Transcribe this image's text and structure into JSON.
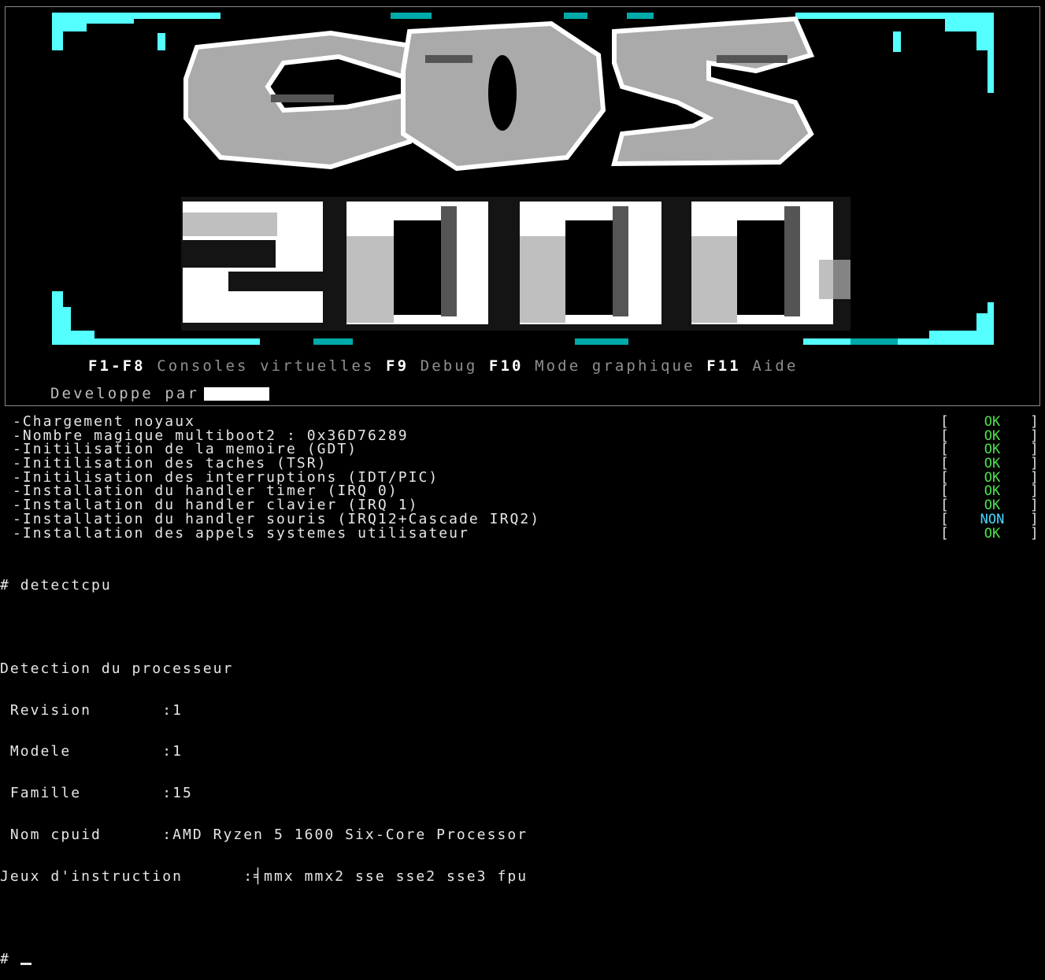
{
  "logo": {
    "top_text": "OS",
    "year_text": "2000",
    "colors": {
      "cyan": "#55ffff",
      "teal": "#00aaaa",
      "gray": "#aaaaaa",
      "dark": "#555555",
      "white": "#ffffff"
    }
  },
  "help_bar": [
    {
      "key": "F1-F8",
      "desc": "Consoles virtuelles"
    },
    {
      "key": "F9",
      "desc": "Debug"
    },
    {
      "key": "F10",
      "desc": "Mode graphique"
    },
    {
      "key": "F11",
      "desc": "Aide"
    }
  ],
  "developer": {
    "label": "Developpe par"
  },
  "boot_log": [
    {
      "text": "-Chargement noyaux",
      "status": "OK"
    },
    {
      "text": "-Nombre magique multiboot2 : 0x36D76289",
      "status": "OK"
    },
    {
      "text": "-Initilisation de la memoire (GDT)",
      "status": "OK"
    },
    {
      "text": "-Initilisation des taches (TSR)",
      "status": "OK"
    },
    {
      "text": "-Initilisation des interruptions (IDT/PIC)",
      "status": "OK"
    },
    {
      "text": "-Installation du handler timer (IRQ 0)",
      "status": "OK"
    },
    {
      "text": "-Installation du handler clavier (IRQ 1)",
      "status": "OK"
    },
    {
      "text": "-Installation du handler souris (IRQ12+Cascade IRQ2)",
      "status": "NON"
    },
    {
      "text": "-Installation des appels systemes utilisateur",
      "status": "OK"
    }
  ],
  "bracket_open": "[",
  "bracket_close": "]",
  "terminal": {
    "command_line": "# detectcpu",
    "heading": "Detection du processeur",
    "fields": [
      {
        "line": " Revision       :1"
      },
      {
        "line": " Modele         :1"
      },
      {
        "line": " Famille        :15"
      },
      {
        "line": " Nom cpuid      :AMD Ryzen 5 1600 Six-Core Processor"
      },
      {
        "line": "Jeux d'instruction      :╡mmx mmx2 sse sse2 sse3 fpu"
      }
    ],
    "prompt": "# "
  }
}
